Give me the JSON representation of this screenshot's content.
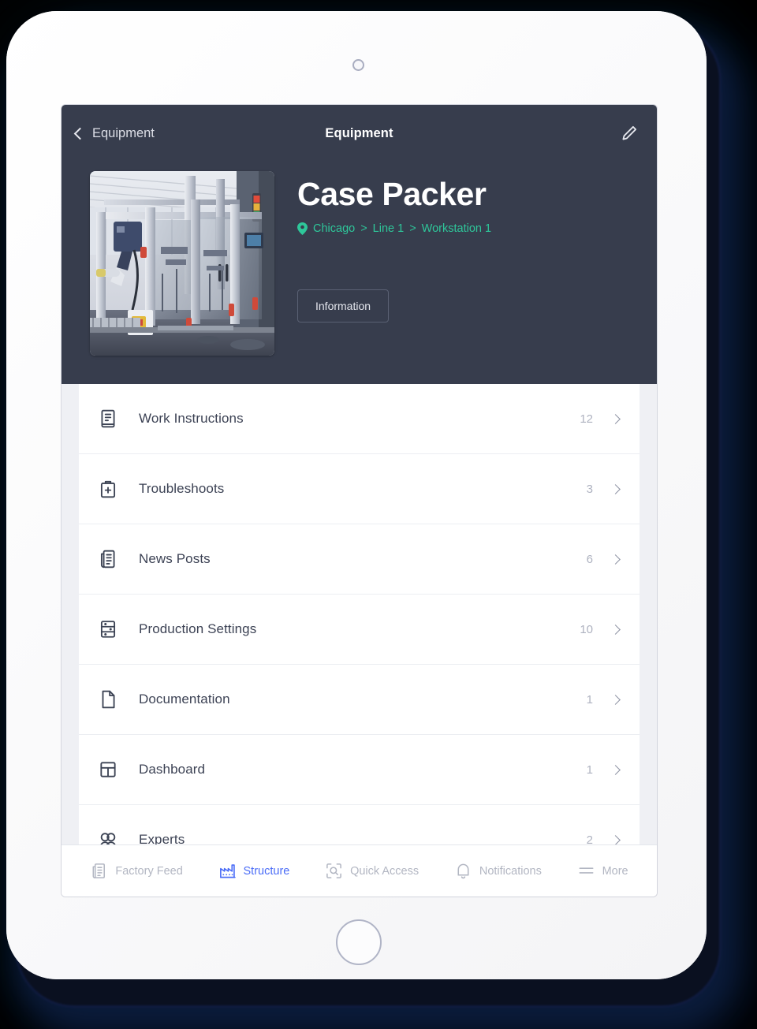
{
  "device": {
    "type": "tablet",
    "camera_icon": "camera-dot",
    "home_button_icon": "home-button"
  },
  "navbar": {
    "back_label": "Equipment",
    "back_icon": "chevron-left-icon",
    "title": "Equipment",
    "edit_icon": "pencil-icon"
  },
  "hero": {
    "image_alt": "case-packer-machine-photo",
    "title": "Case Packer",
    "breadcrumb": {
      "pin_icon": "location-pin-icon",
      "separator": ">",
      "items": [
        {
          "label": "Chicago"
        },
        {
          "label": "Line 1"
        },
        {
          "label": "Workstation 1"
        }
      ]
    },
    "information_button": "Information"
  },
  "colors": {
    "header_bg": "#373D4D",
    "accent_green": "#2EC79A",
    "accent_blue": "#4A6CF7",
    "screen_bg": "#EFF0F4",
    "card_bg": "#FFFFFF",
    "label_text": "#3C4254",
    "count_text": "#AEB2C0"
  },
  "list": {
    "rows": [
      {
        "icon": "book-instructions-icon",
        "label": "Work Instructions",
        "count": "12",
        "chevron": "chevron-right-icon"
      },
      {
        "icon": "first-aid-kit-icon",
        "label": "Troubleshoots",
        "count": "3",
        "chevron": "chevron-right-icon"
      },
      {
        "icon": "newspaper-icon",
        "label": "News Posts",
        "count": "6",
        "chevron": "chevron-right-icon"
      },
      {
        "icon": "sliders-settings-icon",
        "label": "Production Settings",
        "count": "10",
        "chevron": "chevron-right-icon"
      },
      {
        "icon": "document-page-icon",
        "label": "Documentation",
        "count": "1",
        "chevron": "chevron-right-icon"
      },
      {
        "icon": "dashboard-grid-icon",
        "label": "Dashboard",
        "count": "1",
        "chevron": "chevron-right-icon"
      },
      {
        "icon": "experts-people-icon",
        "label": "Experts",
        "count": "2",
        "chevron": "chevron-right-icon"
      }
    ]
  },
  "tabbar": {
    "items": [
      {
        "icon": "factory-feed-icon",
        "label": "Factory Feed",
        "active": false
      },
      {
        "icon": "structure-factory-icon",
        "label": "Structure",
        "active": true
      },
      {
        "icon": "quick-access-scan-icon",
        "label": "Quick Access",
        "active": false
      },
      {
        "icon": "bell-notifications-icon",
        "label": "Notifications",
        "active": false
      },
      {
        "icon": "hamburger-more-icon",
        "label": "More",
        "active": false
      }
    ]
  }
}
